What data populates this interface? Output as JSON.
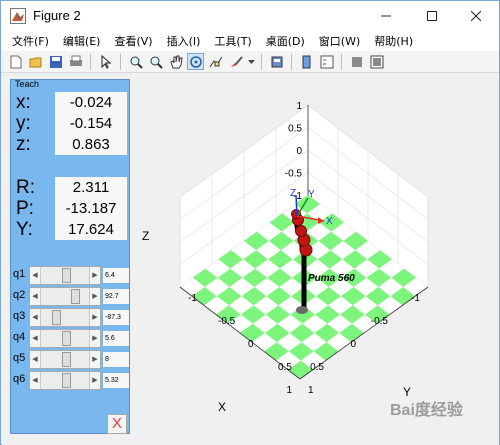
{
  "window": {
    "title": "Figure 2"
  },
  "menu": [
    {
      "label": "文件(F)"
    },
    {
      "label": "编辑(E)"
    },
    {
      "label": "查看(V)"
    },
    {
      "label": "插入(I)"
    },
    {
      "label": "工具(T)"
    },
    {
      "label": "桌面(D)"
    },
    {
      "label": "窗口(W)"
    },
    {
      "label": "帮助(H)"
    }
  ],
  "teach": {
    "title": "Teach",
    "coords": [
      {
        "label": "x:",
        "value": "-0.024"
      },
      {
        "label": "y:",
        "value": "-0.154"
      },
      {
        "label": "z:",
        "value": "0.863"
      },
      {
        "label": "R:",
        "value": "2.311"
      },
      {
        "label": "P:",
        "value": "-13.187"
      },
      {
        "label": "Y:",
        "value": "17.624"
      }
    ],
    "joints": [
      {
        "label": "q1",
        "value": "6.4",
        "slider_fraction": 0.52
      },
      {
        "label": "q2",
        "value": "92.7",
        "slider_fraction": 0.75
      },
      {
        "label": "q3",
        "value": "-87.3",
        "slider_fraction": 0.26
      },
      {
        "label": "q4",
        "value": "5.6",
        "slider_fraction": 0.52
      },
      {
        "label": "q5",
        "value": "8",
        "slider_fraction": 0.52
      },
      {
        "label": "q6",
        "value": "5.32",
        "slider_fraction": 0.52
      }
    ],
    "quit_label": "X"
  },
  "plot": {
    "robot_name": "Puma 560",
    "z_axis_label": "Z",
    "x_axis_label": "X",
    "y_axis_label": "Y",
    "z_ticks": [
      "1",
      "0.5",
      "0",
      "-0.5",
      "-1"
    ],
    "x_ticks": [
      "-1",
      "-0.5",
      "0",
      "0.5",
      "1"
    ],
    "y_ticks": [
      "1",
      "0.5",
      "0",
      "-0.5",
      "-1"
    ],
    "frame_axes": {
      "x": "X",
      "y": "Y",
      "z": "Z"
    },
    "colors": {
      "floor_tile": "#7df57d",
      "floor_light": "#ffffff",
      "link": "#000000",
      "joint": "#c41515",
      "frame_x": "#e02a2a",
      "frame_y": "#1e8a1e",
      "frame_z": "#1a3cd6"
    }
  },
  "watermark": "Bai度经验"
}
